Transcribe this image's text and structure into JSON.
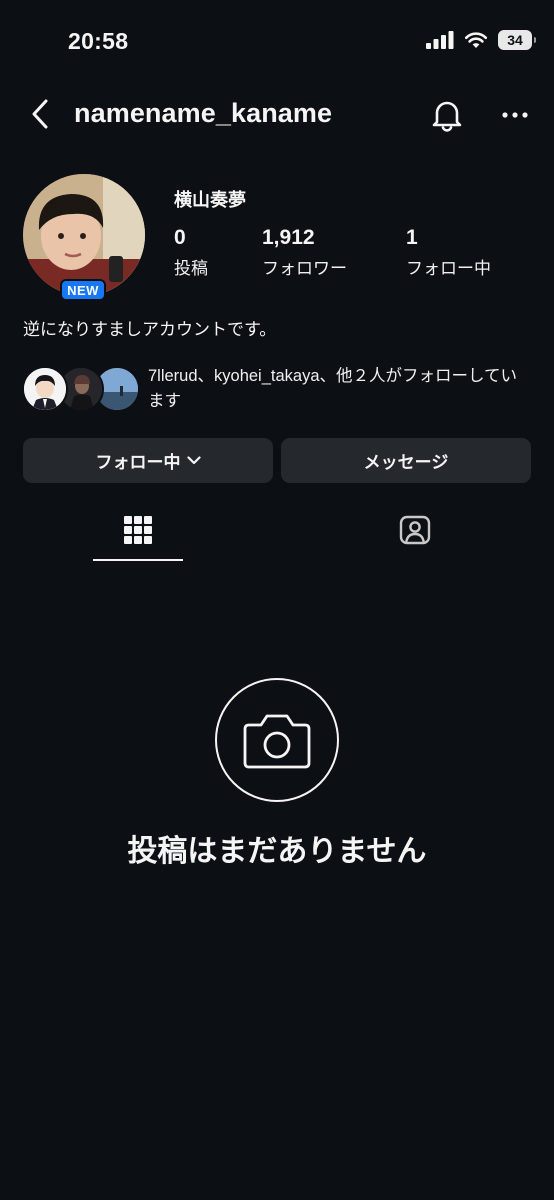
{
  "status_bar": {
    "time": "20:58",
    "battery": "34"
  },
  "header": {
    "username": "namename_kaname"
  },
  "profile": {
    "display_name": "横山奏夢",
    "new_badge": "NEW",
    "bio": "逆になりすましアカウントです。",
    "stats": {
      "posts": {
        "value": "0",
        "label": "投稿"
      },
      "followers": {
        "value": "1,912",
        "label": "フォロワー"
      },
      "following": {
        "value": "1",
        "label": "フォロー中"
      }
    },
    "mutual_text": "7llerud、kyohei_takaya、他２人がフォローしています"
  },
  "actions": {
    "following_label": "フォロー中",
    "message_label": "メッセージ"
  },
  "tabs": [
    {
      "name": "grid",
      "icon": "grid-icon",
      "active": true
    },
    {
      "name": "tagged",
      "icon": "tagged-person-icon",
      "active": false
    }
  ],
  "empty_state": {
    "icon": "camera-icon",
    "text": "投稿はまだありません"
  },
  "colors": {
    "background": "#0c1014",
    "button": "#25292e",
    "badge": "#1877f2",
    "text": "#f5f5f5"
  }
}
